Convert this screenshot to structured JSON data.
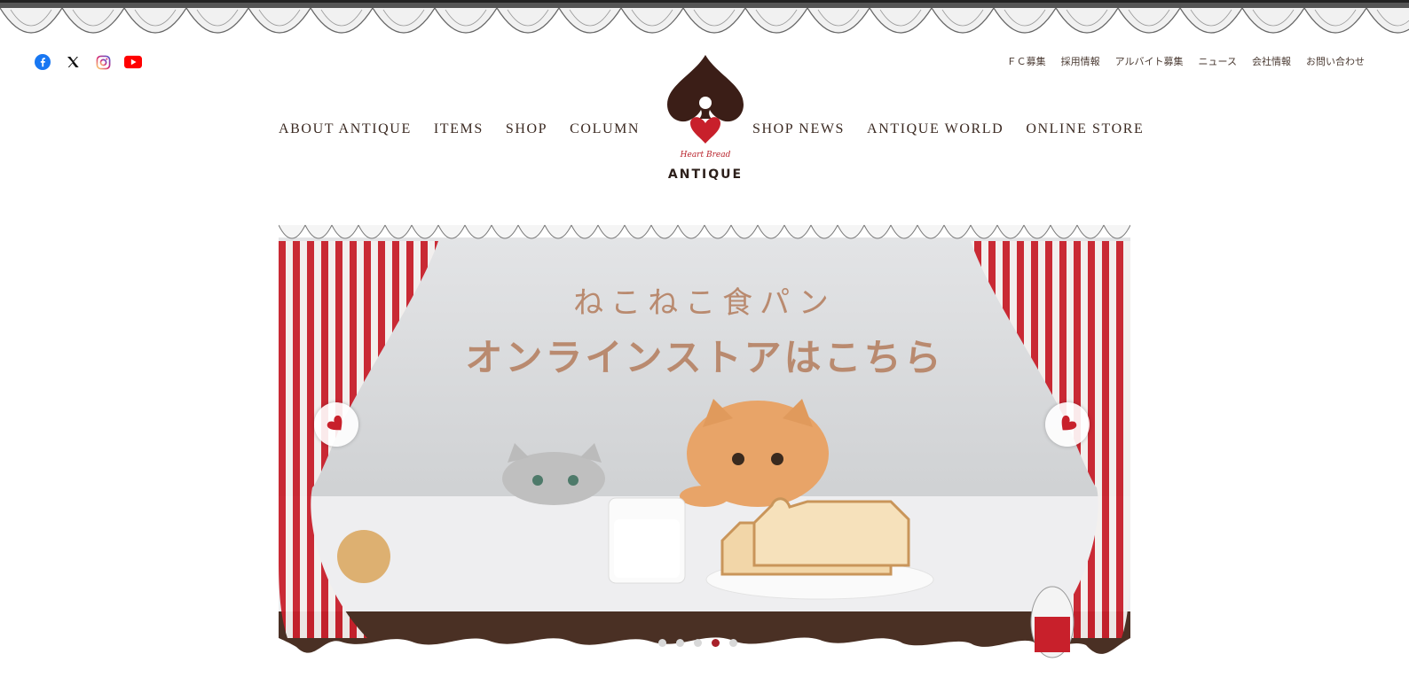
{
  "social": [
    {
      "icon": "facebook-icon",
      "color": "#1877f2"
    },
    {
      "icon": "x-icon",
      "color": "#000000"
    },
    {
      "icon": "instagram-icon",
      "color": "#d62976"
    },
    {
      "icon": "youtube-icon",
      "color": "#ff0000"
    }
  ],
  "util_nav": [
    "ＦＣ募集",
    "採用情報",
    "アルバイト募集",
    "ニュース",
    "会社情報",
    "お問い合わせ"
  ],
  "nav_left": [
    "ABOUT ANTIQUE",
    "ITEMS",
    "SHOP",
    "COLUMN"
  ],
  "nav_right": [
    "SHOP NEWS",
    "ANTIQUE WORLD",
    "ONLINE STORE"
  ],
  "logo": {
    "tagline": "Heart Bread",
    "brand": "ANTIQUE",
    "accent": "#c8202b",
    "dark": "#3b1e17"
  },
  "hero": {
    "line1": "ねこねこ食パン",
    "line2": "オンラインストアはこちら",
    "text_color": "#b98a6f",
    "slides": 5,
    "active_slide": 4
  }
}
